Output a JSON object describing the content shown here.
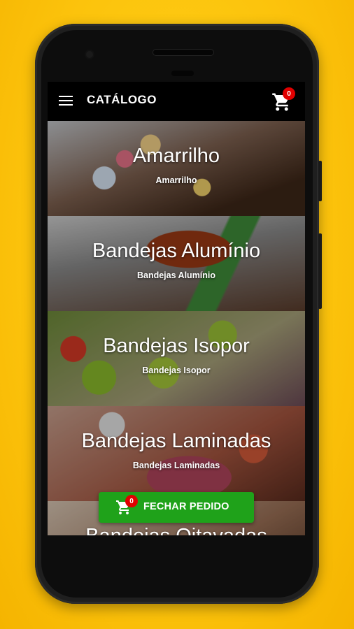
{
  "colors": {
    "background": "#fcc30c",
    "appbar": "#000000",
    "fab": "#1fa21a",
    "badge": "#e10000"
  },
  "appbar": {
    "title": "CATÁLOGO",
    "menu_icon": "menu-icon",
    "cart_icon": "cart-icon",
    "cart_count": "0"
  },
  "categories": [
    {
      "title": "Amarrilho",
      "subtitle": "Amarrilho"
    },
    {
      "title": "Bandejas Alumínio",
      "subtitle": "Bandejas Alumínio"
    },
    {
      "title": "Bandejas Isopor",
      "subtitle": "Bandejas Isopor"
    },
    {
      "title": "Bandejas Laminadas",
      "subtitle": "Bandejas Laminadas"
    },
    {
      "title": "Bandejas Oitavadas",
      "subtitle": ""
    }
  ],
  "fab": {
    "label": "FECHAR PEDIDO",
    "cart_count": "0",
    "icon": "cart-icon"
  }
}
